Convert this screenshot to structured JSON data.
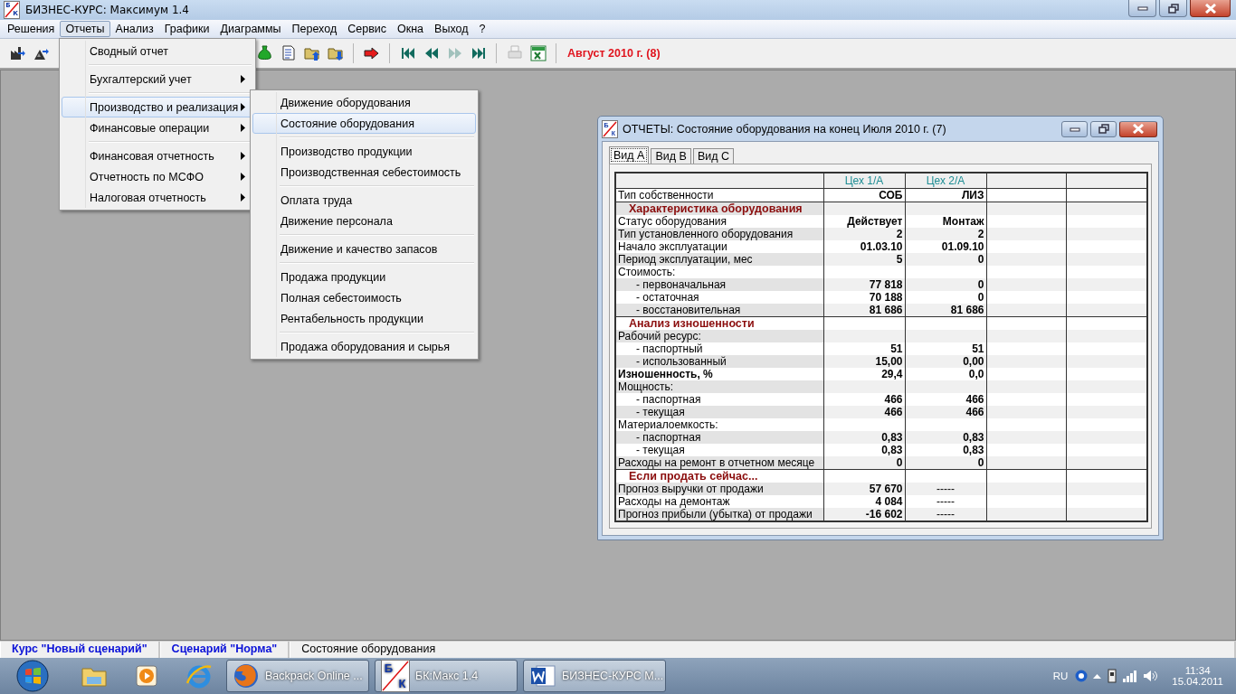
{
  "window": {
    "logo_letters": [
      "Б",
      "К"
    ],
    "title": "БИЗНЕС-КУРС: Максимум 1.4"
  },
  "menubar": [
    {
      "label": "Решения",
      "selected": false
    },
    {
      "label": "Отчеты",
      "selected": true
    },
    {
      "label": "Анализ",
      "selected": false
    },
    {
      "label": "Графики",
      "selected": false
    },
    {
      "label": "Диаграммы",
      "selected": false
    },
    {
      "label": "Переход",
      "selected": false
    },
    {
      "label": "Сервис",
      "selected": false
    },
    {
      "label": "Окна",
      "selected": false
    },
    {
      "label": "Выход",
      "selected": false
    },
    {
      "label": "?",
      "selected": false
    }
  ],
  "toolbar": {
    "buttons_left": [
      {
        "kind": "factory",
        "disabled": false
      },
      {
        "kind": "pyramid",
        "disabled": false
      }
    ],
    "buttons_right": [
      {
        "kind": "moneybag",
        "disabled": false
      },
      {
        "kind": "document",
        "disabled": false
      },
      {
        "kind": "folder-up",
        "disabled": false
      },
      {
        "kind": "folder-down",
        "disabled": false
      },
      {
        "kind": "sep"
      },
      {
        "kind": "arrow",
        "disabled": false
      },
      {
        "kind": "sep"
      },
      {
        "kind": "first",
        "disabled": false
      },
      {
        "kind": "back",
        "disabled": false
      },
      {
        "kind": "forward",
        "disabled": true
      },
      {
        "kind": "last",
        "disabled": false
      },
      {
        "kind": "sep"
      },
      {
        "kind": "printer",
        "disabled": true
      },
      {
        "kind": "excel",
        "disabled": false
      },
      {
        "kind": "sep"
      }
    ],
    "period": "Август 2010 г. (8)"
  },
  "reports_menu": {
    "groups": [
      [
        {
          "label": "Сводный отчет",
          "has_submenu": false,
          "selected": false
        }
      ],
      [
        {
          "label": "Бухгалтерский учет",
          "has_submenu": true,
          "selected": false
        }
      ],
      [
        {
          "label": "Производство и реализация",
          "has_submenu": true,
          "selected": true
        },
        {
          "label": "Финансовые операции",
          "has_submenu": true,
          "selected": false
        }
      ],
      [
        {
          "label": "Финансовая отчетность",
          "has_submenu": true,
          "selected": false
        },
        {
          "label": "Отчетность по МСФО",
          "has_submenu": true,
          "selected": false
        },
        {
          "label": "Налоговая отчетность",
          "has_submenu": true,
          "selected": false
        }
      ]
    ]
  },
  "submenu": {
    "groups": [
      [
        {
          "label": "Движение оборудования",
          "selected": false
        },
        {
          "label": "Состояние оборудования",
          "selected": true
        }
      ],
      [
        {
          "label": "Производство продукции",
          "selected": false
        },
        {
          "label": "Производственная себестоимость",
          "selected": false
        }
      ],
      [
        {
          "label": "Оплата труда",
          "selected": false
        },
        {
          "label": "Движение персонала",
          "selected": false
        }
      ],
      [
        {
          "label": "Движение и качество запасов",
          "selected": false
        }
      ],
      [
        {
          "label": "Продажа продукции",
          "selected": false
        },
        {
          "label": "Полная себестоимость",
          "selected": false
        },
        {
          "label": "Рентабельность продукции",
          "selected": false
        }
      ],
      [
        {
          "label": "Продажа оборудования и сырья",
          "selected": false
        }
      ]
    ]
  },
  "report_window": {
    "logo_letters": [
      "Б",
      "К"
    ],
    "title": "ОТЧЕТЫ: Состояние оборудования на конец Июля 2010 г. (7)",
    "tabs": [
      {
        "label": "Вид А",
        "selected": true
      },
      {
        "label": "Вид В",
        "selected": false
      },
      {
        "label": "Вид С",
        "selected": false
      }
    ],
    "table": {
      "columns": [
        "Цех 1/А",
        "Цех 2/А"
      ],
      "groups": [
        {
          "rows": [
            {
              "label": "Тип собственности",
              "kind": "item",
              "values": [
                "СОБ",
                "ЛИЗ"
              ]
            }
          ]
        },
        {
          "rows": [
            {
              "label": "Характеристика оборудования",
              "kind": "section"
            },
            {
              "label": "Статус оборудования",
              "kind": "item",
              "values": [
                "Действует",
                "Монтаж"
              ]
            },
            {
              "label": "Тип установленного оборудования",
              "kind": "item",
              "values": [
                "2",
                "2"
              ]
            },
            {
              "label": "Начало эксплуатации",
              "kind": "item",
              "values": [
                "01.03.10",
                "01.09.10"
              ]
            },
            {
              "label": "Период эксплуатации, мес",
              "kind": "item",
              "values": [
                "5",
                "0"
              ]
            },
            {
              "label": "Стоимость:",
              "kind": "item"
            },
            {
              "label": "- первоначальная",
              "kind": "sub",
              "values": [
                "77 818",
                "0"
              ]
            },
            {
              "label": "- остаточная",
              "kind": "sub",
              "values": [
                "70 188",
                "0"
              ]
            },
            {
              "label": "- восстановительная",
              "kind": "sub",
              "values": [
                "81 686",
                "81 686"
              ]
            }
          ]
        },
        {
          "rows": [
            {
              "label": "Анализ изношенности",
              "kind": "section"
            },
            {
              "label": "Рабочий ресурс:",
              "kind": "item"
            },
            {
              "label": "- паспортный",
              "kind": "sub",
              "values": [
                "51",
                "51"
              ]
            },
            {
              "label": "- использованный",
              "kind": "sub",
              "values": [
                "15,00",
                "0,00"
              ]
            },
            {
              "label": "Изношенность, %",
              "kind": "total",
              "values": [
                "29,4",
                "0,0"
              ]
            },
            {
              "label": "Мощность:",
              "kind": "item"
            },
            {
              "label": "- паспортная",
              "kind": "sub",
              "values": [
                "466",
                "466"
              ]
            },
            {
              "label": "- текущая",
              "kind": "sub",
              "values": [
                "466",
                "466"
              ]
            },
            {
              "label": "Материалоемкость:",
              "kind": "item"
            },
            {
              "label": "- паспортная",
              "kind": "sub",
              "values": [
                "0,83",
                "0,83"
              ]
            },
            {
              "label": "- текущая",
              "kind": "sub",
              "values": [
                "0,83",
                "0,83"
              ]
            },
            {
              "label": "Расходы на ремонт в отчетном месяце",
              "kind": "item",
              "values": [
                "0",
                "0"
              ]
            }
          ]
        },
        {
          "rows": [
            {
              "label": "Если продать сейчас...",
              "kind": "section"
            },
            {
              "label": "Прогноз выручки от продажи",
              "kind": "item",
              "values": [
                "57 670",
                "-----"
              ],
              "second_not_applicable": true
            },
            {
              "label": "Расходы на демонтаж",
              "kind": "item",
              "values": [
                "4 084",
                "-----"
              ],
              "second_not_applicable": true
            },
            {
              "label": "Прогноз прибыли (убытка) от продажи",
              "kind": "item",
              "values": [
                "-16 602",
                "-----"
              ],
              "second_not_applicable": true
            }
          ]
        }
      ]
    }
  },
  "status_bar": [
    {
      "text": "Курс \"Новый сценарий\"",
      "kind": "scenario"
    },
    {
      "text": "Сценарий \"Норма\"",
      "kind": "scenario"
    },
    {
      "text": "Состояние оборудования",
      "kind": "plain"
    }
  ],
  "taskbar": {
    "pinned": [
      {
        "kind": "folder"
      },
      {
        "kind": "player"
      },
      {
        "kind": "ie"
      }
    ],
    "tasks": [
      {
        "kind": "firefox",
        "label": "Backpack Online ..."
      },
      {
        "kind": "app",
        "label": "БК:Макс 1.4",
        "logo_letters": [
          "Б",
          "К"
        ]
      },
      {
        "kind": "word",
        "label": "БИЗНЕС-КУРС М..."
      }
    ],
    "tray": {
      "language": "RU",
      "time": "11:34",
      "date": "15.04.2011"
    }
  }
}
